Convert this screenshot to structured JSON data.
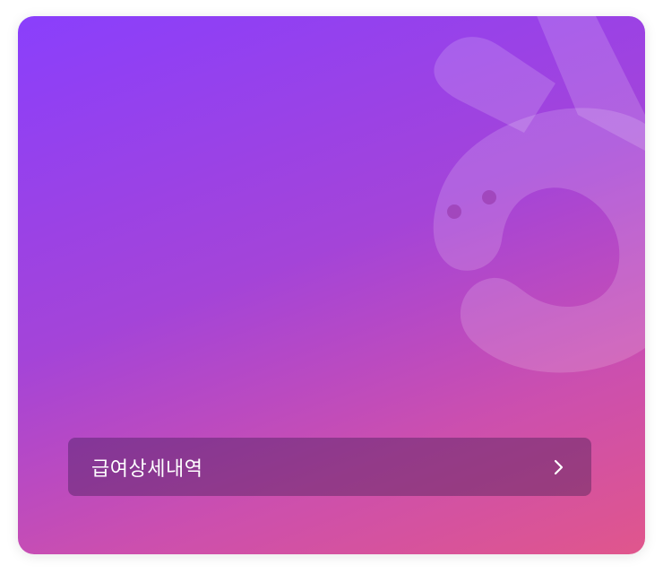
{
  "card": {
    "gradient_start": "#8a3ffc",
    "gradient_end": "#e0568c",
    "button_label": "급여상세내역",
    "button_icon": "chevron-right-icon",
    "mascot_icon": "rabbit-mascot-icon"
  }
}
